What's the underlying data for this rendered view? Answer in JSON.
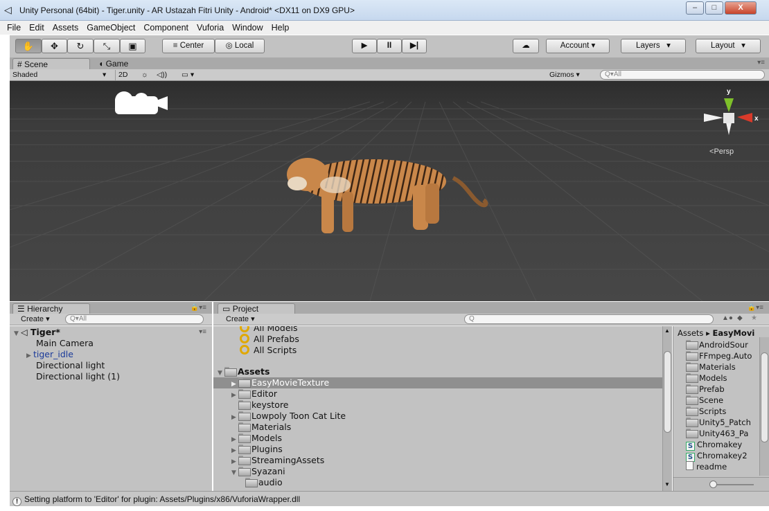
{
  "window": {
    "title": "Unity Personal (64bit) - Tiger.unity - AR Ustazah Fitri Unity - Android* <DX11 on DX9 GPU>",
    "minimize": "–",
    "maximize": "□",
    "close": "X"
  },
  "menu": [
    "File",
    "Edit",
    "Assets",
    "GameObject",
    "Component",
    "Vuforia",
    "Window",
    "Help"
  ],
  "toolbar": {
    "pivot": "Center",
    "space": "Local",
    "account": "Account",
    "layers": "Layers",
    "layout": "Layout",
    "play": "▶",
    "pause": "II",
    "step": "▶|"
  },
  "scene": {
    "tabs": [
      "Scene",
      "Game"
    ],
    "shading": "Shaded",
    "mode_2d": "2D",
    "gizmos": "Gizmos",
    "search_placeholder": "All",
    "persp": "Persp",
    "axis_y": "y",
    "axis_x": "x"
  },
  "hierarchy": {
    "tab": "Hierarchy",
    "create": "Create",
    "search_placeholder": "All",
    "scene_name": "Tiger*",
    "items": [
      "Main Camera",
      "tiger_idle",
      "Directional light",
      "Directional light (1)"
    ]
  },
  "project": {
    "tab": "Project",
    "create": "Create",
    "favorites": [
      "All Models",
      "All Prefabs",
      "All Scripts"
    ],
    "assets_root": "Assets",
    "tree": [
      "EasyMovieTexture",
      "Editor",
      "keystore",
      "Lowpoly Toon Cat Lite",
      "Materials",
      "Models",
      "Plugins",
      "StreamingAssets",
      "Syazani",
      "audio"
    ],
    "breadcrumb_root": "Assets",
    "breadcrumb_current": "EasyMovi",
    "files": [
      "AndroidSour",
      "FFmpeg.Auto",
      "Materials",
      "Models",
      "Prefab",
      "Scene",
      "Scripts",
      "Unity5_Patch",
      "Unity463_Pa",
      "Chromakey",
      "Chromakey2",
      "readme"
    ]
  },
  "status": {
    "message": "Setting platform to 'Editor' for plugin: Assets/Plugins/x86/VuforiaWrapper.dll"
  },
  "colors": {
    "scene_bg": "#474747",
    "panel_bg": "#c2c2c2",
    "selection": "#8f8f8f",
    "tiger": "#c9874a",
    "gizmo_y": "#7ec02a",
    "gizmo_x": "#d83a2a"
  }
}
